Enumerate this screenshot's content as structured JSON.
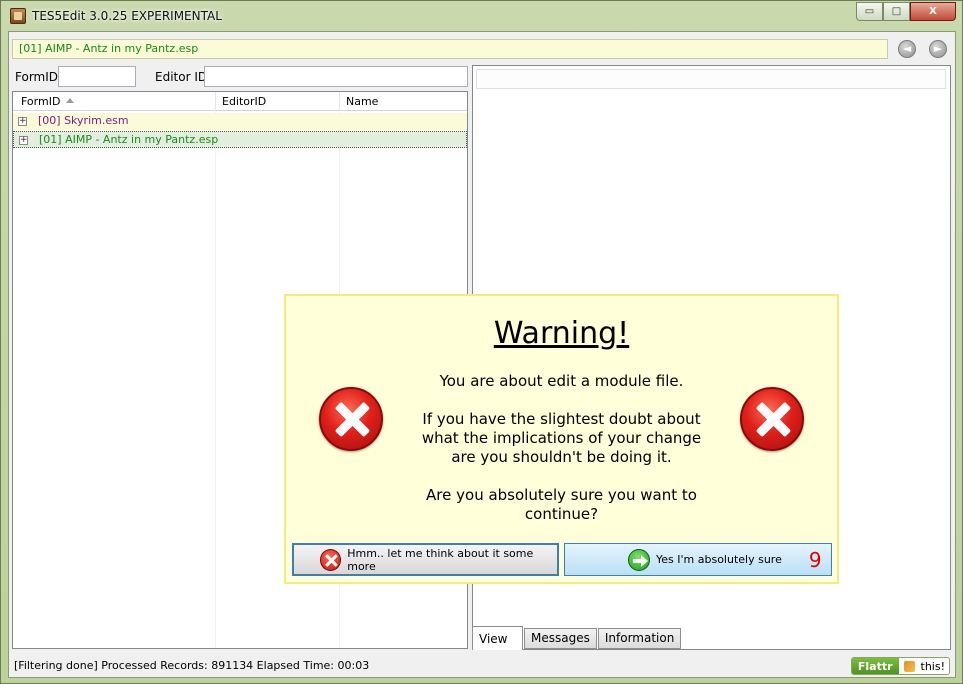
{
  "window": {
    "title": "TES5Edit 3.0.25 EXPERIMENTAL",
    "minimize_glyph": "▭",
    "maximize_glyph": "□",
    "close_glyph": "X"
  },
  "filebar": {
    "current_file": "[01] AIMP - Antz in my Pantz.esp",
    "back_glyph": "◄",
    "forward_glyph": "►"
  },
  "search": {
    "formid_label": "FormID",
    "editorid_label": "Editor ID",
    "formid_value": "",
    "editorid_value": ""
  },
  "tree": {
    "columns": [
      "FormID",
      "EditorID",
      "Name"
    ],
    "rows": [
      {
        "expander": "+",
        "label": "[00] Skyrim.esm",
        "color": "#7c1f8c"
      },
      {
        "expander": "+",
        "label": "[01] AIMP - Antz in my Pantz.esp",
        "color": "#1b8a1b"
      }
    ]
  },
  "tabs": [
    "View",
    "Messages",
    "Information"
  ],
  "status": {
    "text": "[Filtering done]  Processed Records: 891134 Elapsed Time: 00:03",
    "flattr_label": "Flattr",
    "flattr_this": "this!"
  },
  "dialog": {
    "title": "Warning!",
    "body": "You are about edit a module file.\n\nIf you have the slightest doubt about\nwhat the implications of your change\nare you shouldn't be doing it.\n\nAre you absolutely sure you want to\ncontinue?",
    "no_button": "Hmm.. let me think about it some more",
    "yes_button": "Yes I'm absolutely sure",
    "countdown": "9"
  },
  "colors": {
    "dialog_bg": "#ffffd9",
    "skyrim_text": "#7c1f8c",
    "aimp_text": "#1b8a1b",
    "countdown": "#e00000"
  }
}
